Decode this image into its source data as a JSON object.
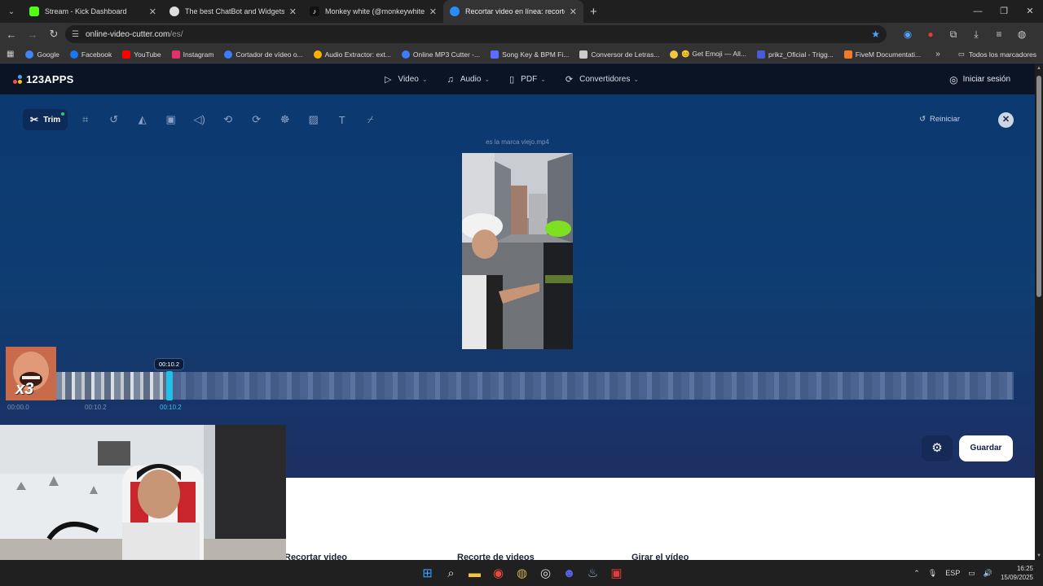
{
  "browser": {
    "tabs": [
      {
        "title": "Stream - Kick Dashboard",
        "favicon_color": "#53fc18"
      },
      {
        "title": "The best ChatBot and Widgets",
        "favicon_color": "#dddddd"
      },
      {
        "title": "Monkey white (@monkeywhite",
        "favicon_color": "#111111"
      },
      {
        "title": "Recortar video en línea: recorte",
        "favicon_color": "#2b8cff"
      }
    ],
    "url_host": "online-video-cutter.com",
    "url_path": "/es/",
    "bookmarks": [
      {
        "label": "Google",
        "color": "#4285f4"
      },
      {
        "label": "Facebook",
        "color": "#1877f2"
      },
      {
        "label": "YouTube",
        "color": "#ff0000"
      },
      {
        "label": "Instagram",
        "color": "#e1306c"
      },
      {
        "label": "Cortador de vídeo o...",
        "color": "#3d7bff"
      },
      {
        "label": "Audio Extractor: ext...",
        "color": "#ffb300"
      },
      {
        "label": "Online MP3 Cutter -...",
        "color": "#3d7bff"
      },
      {
        "label": "Song Key & BPM Fi...",
        "color": "#5b6cff"
      },
      {
        "label": "Conversor de Letras...",
        "color": "#cccccc"
      },
      {
        "label": "😊 Get Emoji — All...",
        "color": "#f5c542"
      },
      {
        "label": "prikz_Oficial - Trigg...",
        "color": "#4a5bd8"
      },
      {
        "label": "FiveM Documentati...",
        "color": "#f07b2c"
      }
    ],
    "bookmarks_all": "Todos los marcadores"
  },
  "site": {
    "logo": "123APPS",
    "nav": [
      {
        "label": "Video",
        "icon": "play-icon"
      },
      {
        "label": "Audio",
        "icon": "music-icon"
      },
      {
        "label": "PDF",
        "icon": "file-icon"
      },
      {
        "label": "Convertidores",
        "icon": "convert-icon"
      }
    ],
    "login": "Iniciar sesión"
  },
  "editor": {
    "active_tool": "Trim",
    "reset": "Reiniciar",
    "filename": "es la marca viejo.mp4",
    "playhead_time": "00:10.2",
    "ticks": [
      "00:00.0",
      "00:10.2",
      "00:10.2"
    ],
    "save": "Guardar",
    "progress_fraction": 0.12
  },
  "below": {
    "headings": [
      "Recortar video",
      "Recorte de videos",
      "Girar el vídeo"
    ]
  },
  "overlay": {
    "label": "x3"
  },
  "taskbar": {
    "lang": "ESP",
    "time": "16:25",
    "date": "15/09/2025"
  }
}
